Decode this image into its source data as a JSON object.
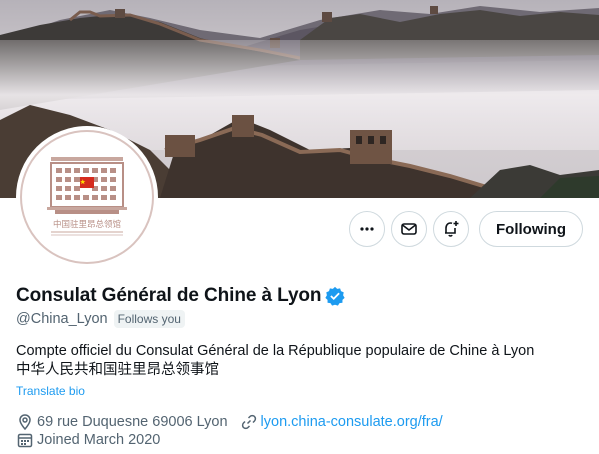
{
  "profile": {
    "display_name": "Consulat Général de Chine à Lyon",
    "handle": "@China_Lyon",
    "follows_you": "Follows you",
    "bio_line1": "Compte officiel du Consulat Général de la République populaire de Chine à Lyon",
    "bio_line2": "中华人民共和国驻里昂总领事馆",
    "translate_bio": "Translate bio",
    "location": "69 rue Duquesne 69006 Lyon",
    "website": "lyon.china-consulate.org/fra/",
    "joined": "Joined March 2020",
    "avatar_caption": "中国驻里昂总领馆"
  },
  "actions": {
    "more_icon": "more-icon",
    "message_icon": "message-icon",
    "notify_icon": "notification-bell-plus-icon",
    "follow_label": "Following"
  },
  "icons": {
    "verified": "verified-badge-icon",
    "location": "location-pin-icon",
    "link": "link-icon",
    "calendar": "calendar-icon"
  },
  "colors": {
    "accent": "#1d9bf0",
    "muted_text": "#536471",
    "border": "#cfd9de",
    "flag_red": "#d52b1e"
  }
}
